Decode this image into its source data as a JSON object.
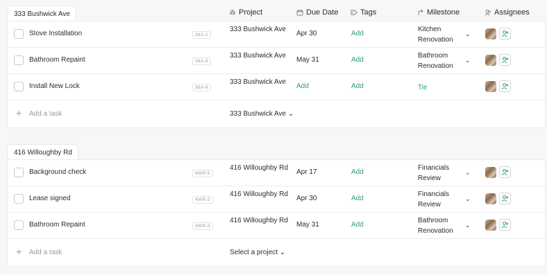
{
  "columns": {
    "project": "Project",
    "due_date": "Due Date",
    "tags": "Tags",
    "milestone": "Milestone",
    "assignees": "Assignees"
  },
  "groups": [
    {
      "name": "333 Bushwick Ave",
      "tasks": [
        {
          "name": "Stove Installation",
          "id": "38A-2",
          "project": "333 Bushwick Ave",
          "due": "Apr 30",
          "tags": "Add",
          "milestone": "Kitchen Renovation"
        },
        {
          "name": "Bathroom Repaint",
          "id": "38A-4",
          "project": "333 Bushwick Ave",
          "due": "May 31",
          "tags": "Add",
          "milestone": "Bathroom Renovation"
        },
        {
          "name": "Install New Lock",
          "id": "38A-6",
          "project": "333 Bushwick Ave",
          "due": "Add",
          "tags": "Add",
          "milestone": "Tie"
        }
      ],
      "add_task": "Add a task",
      "project_select": "333 Bushwick Ave"
    },
    {
      "name": "416 Willoughby Rd",
      "tasks": [
        {
          "name": "Background check",
          "id": "4WR-5",
          "project": "416 Willoughby Rd",
          "due": "Apr 17",
          "tags": "Add",
          "milestone": "Financials Review"
        },
        {
          "name": "Lease signed",
          "id": "4WR-2",
          "project": "416 Willoughby Rd",
          "due": "Apr 30",
          "tags": "Add",
          "milestone": "Financials Review"
        },
        {
          "name": "Bathroom Repaint",
          "id": "4WR-3",
          "project": "416 Willoughby Rd",
          "due": "May 31",
          "tags": "Add",
          "milestone": "Bathroom Renovation"
        }
      ],
      "add_task": "Add a task",
      "project_select": "Select a project"
    }
  ],
  "colors": {
    "accent": "#2f9a84",
    "muted": "#9a9aa2"
  }
}
